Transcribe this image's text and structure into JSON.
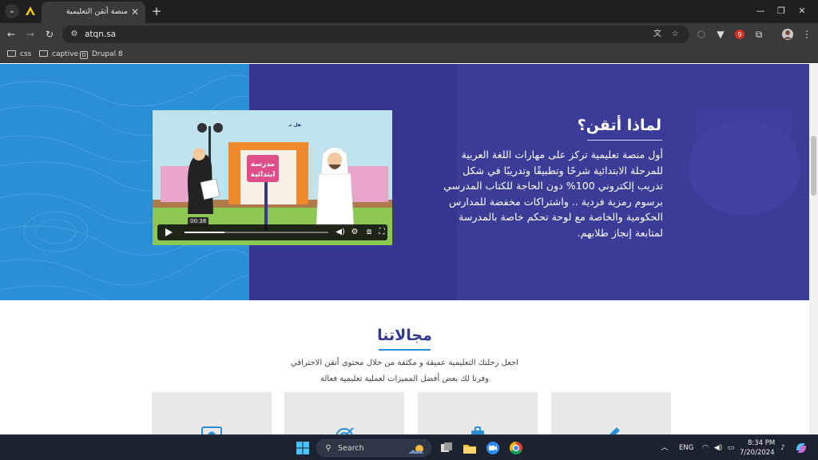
{
  "browser": {
    "tab_title": "منصة أتقن التعليمية",
    "url": "atqn.sa",
    "bookmarks": [
      {
        "label": "css"
      },
      {
        "label": "captive"
      },
      {
        "label": "Drupal 8"
      }
    ],
    "extension_badge": "9"
  },
  "hero": {
    "title": "لماذا أتقن؟",
    "lines": [
      "أول منصة تعليمية تركز على مهارات اللغة العربية",
      "للمرحلة الابتدائية شرحًا وتطبيقًا وتدريبًا في شكل",
      "تدريب إلكتروني 100% دون الحاجة للكتاب المدرسي",
      "برسوم رمزية فردية .. واشتراكات مخفضة للمدارس",
      "الحكومية والخاصة مع لوحة تحكم خاصة بالمدرسة",
      "لمتابعة إنجاز طلابهم."
    ],
    "video": {
      "school_sign_line1": "مدرسة",
      "school_sign_line2": "ابتدائية",
      "top_caption": "هل تـ",
      "time": "00:38",
      "progress": 0.28
    },
    "colors": {
      "left_panel": "#2a8fd4",
      "right_panel": "#3b3b98"
    }
  },
  "fields": {
    "title": "مجالاتنا",
    "line1": "اجعل رحلتك التعليمية عميقة و مكثفة من خلال محتوى أتقن الاحترافي",
    "line2": "وفرنا لك بعض أفضل المميزات لعملية تعليمية فعالة",
    "cards": [
      {
        "icon": "certificate-screen-icon"
      },
      {
        "icon": "target-arrow-icon"
      },
      {
        "icon": "briefcase-icon"
      },
      {
        "icon": "pencil-icon"
      }
    ]
  },
  "taskbar": {
    "search_label": "Search",
    "language": "ENG",
    "time": "8:34 PM",
    "date": "7/20/2024"
  }
}
